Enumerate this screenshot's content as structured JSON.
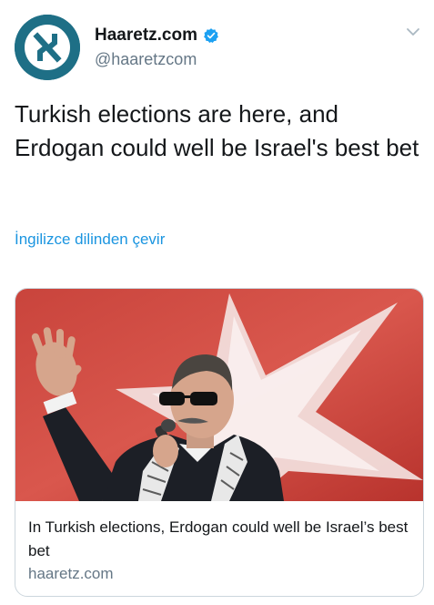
{
  "tweet": {
    "display_name": "Haaretz.com",
    "handle": "@haaretzcom",
    "text": "Turkish elections are here, and Erdogan could well be Israel's best bet",
    "translate_label": "İngilizce dilinden çevir",
    "avatar_icon": "haaretz-logo-icon",
    "verified_icon": "verified-badge-icon",
    "menu_icon": "chevron-down-icon"
  },
  "card": {
    "title": "In Turkish elections, Erdogan could well be Israel’s best bet",
    "domain": "haaretz.com"
  },
  "colors": {
    "avatar_bg": "#1e6f86",
    "link": "#1b95e0",
    "verified": "#1da1f2",
    "secondary_text": "#657786",
    "card_border": "#ccd6dd"
  }
}
